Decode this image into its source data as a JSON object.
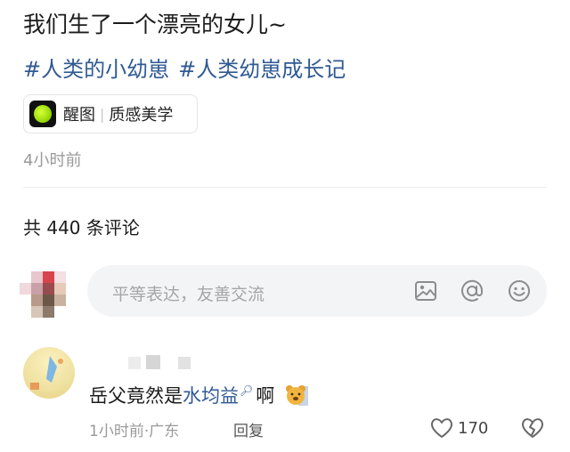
{
  "post": {
    "title": "我们生了一个漂亮的女儿~",
    "tags": [
      "#人类的小幼崽",
      "#人类幼崽成长记"
    ],
    "chip": {
      "name": "醒图",
      "separator": "|",
      "subtitle": "质感美学"
    },
    "time": "4小时前"
  },
  "comments_header": {
    "count_text": "共 440 条评论"
  },
  "comment_input": {
    "placeholder": "平等表达，友善交流",
    "icons": [
      "image-icon",
      "at-icon",
      "emoji-icon"
    ]
  },
  "comment": {
    "text_before": "岳父竟然是",
    "link_text": "水均益",
    "text_after": "啊",
    "search_icon": "search-icon",
    "time": "1小时前",
    "location_sep": "·",
    "location": "广东",
    "reply_label": "回复",
    "like_count": "170"
  },
  "colors": {
    "link": "#2f5a93",
    "muted": "#9a9a9a",
    "input_bg": "#f3f4f6"
  }
}
